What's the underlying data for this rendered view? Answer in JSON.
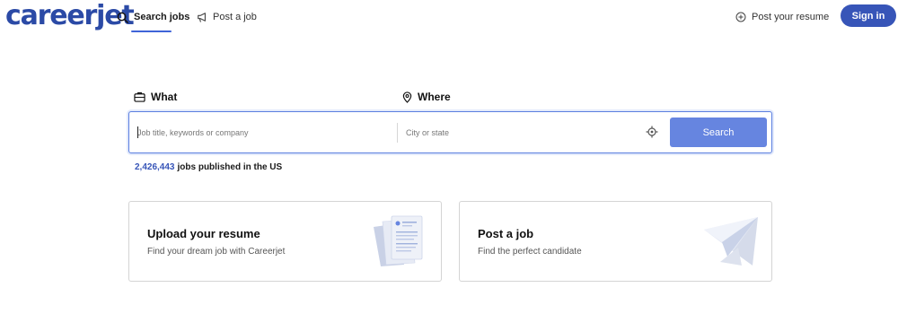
{
  "header": {
    "logo": "careerjet",
    "nav_search": "Search jobs",
    "nav_post": "Post a job",
    "post_resume": "Post your resume",
    "sign_in": "Sign in"
  },
  "search": {
    "what_label": "What",
    "where_label": "Where",
    "what_placeholder": "Job title, keywords or company",
    "where_placeholder": "City or state",
    "button": "Search"
  },
  "stats": {
    "count": "2,426,443",
    "text": "jobs published in the US"
  },
  "cards": [
    {
      "title": "Upload your resume",
      "subtitle": "Find your dream job with Careerjet"
    },
    {
      "title": "Post a job",
      "subtitle": "Find the perfect candidate"
    }
  ],
  "colors": {
    "brand": "#2b4aa6",
    "primary_button": "#3755b8",
    "search_button": "#6685e0"
  },
  "icons": {
    "search_nav": "search-icon",
    "post_nav": "megaphone-icon",
    "resume": "plus-circle-icon",
    "what": "briefcase-icon",
    "where": "map-pin-icon",
    "locate": "crosshair-icon"
  }
}
